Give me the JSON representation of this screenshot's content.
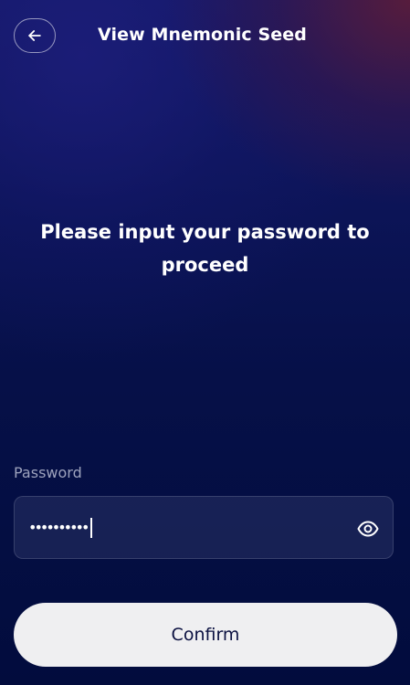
{
  "header": {
    "title": "View Mnemonic Seed",
    "back_icon": "arrow-left-icon"
  },
  "main": {
    "prompt": "Please input your password to proceed"
  },
  "password": {
    "label": "Password",
    "masked_value": "••••••••••",
    "visibility_icon": "eye-icon"
  },
  "actions": {
    "confirm_label": "Confirm"
  },
  "colors": {
    "background_top": "#151a6a",
    "background_bottom": "#020c3d",
    "accent_corner": "#5a1c3a",
    "button_bg": "#efeff1",
    "button_text": "#0a1040",
    "label_text": "#9ea3bd"
  }
}
